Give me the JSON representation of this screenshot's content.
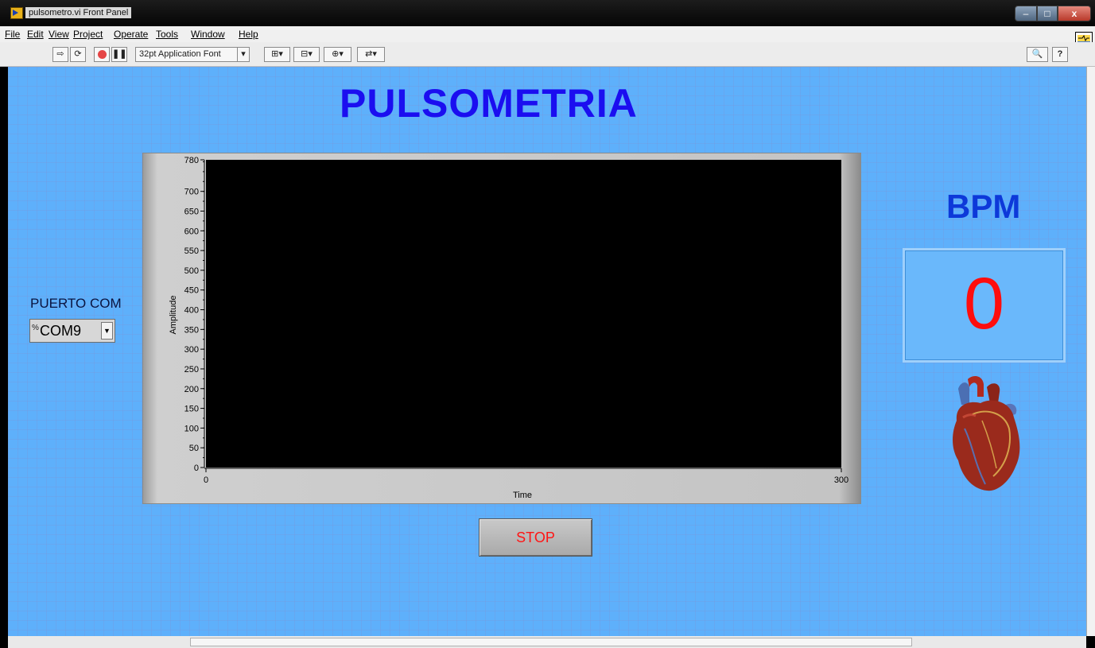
{
  "window": {
    "title": "pulsometro.vi Front Panel",
    "controls": {
      "minimize": "–",
      "maximize": "□",
      "close": "x"
    }
  },
  "menu": [
    "File",
    "Edit",
    "View",
    "Project",
    "Operate",
    "Tools",
    "Window",
    "Help"
  ],
  "toolbar": {
    "font_select": "32pt Application Font",
    "search_placeholder": "Search",
    "help": "?"
  },
  "panel": {
    "title": "PULSOMETRIA",
    "com_label": "PUERTO COM",
    "com_value": "COM9",
    "io_icon": "%",
    "bpm_label": "BPM",
    "bpm_value": "0",
    "stop_label": "STOP",
    "colors": {
      "background": "#5eb0fb",
      "title": "#1b0ef0",
      "bpm_label": "#0d39d9",
      "bpm_value": "#ff0d0d",
      "stop_text": "#ff1414"
    }
  },
  "chart_data": {
    "type": "line",
    "xlabel": "Time",
    "ylabel": "Amplitude",
    "x_ticks": [
      "0",
      "300"
    ],
    "y_ticks": [
      "0",
      "50",
      "100",
      "150",
      "200",
      "250",
      "300",
      "350",
      "400",
      "450",
      "500",
      "550",
      "600",
      "650",
      "700",
      "780"
    ],
    "xlim": [
      0,
      300
    ],
    "ylim": [
      0,
      780
    ],
    "series": [],
    "plot_background": "#000000"
  }
}
